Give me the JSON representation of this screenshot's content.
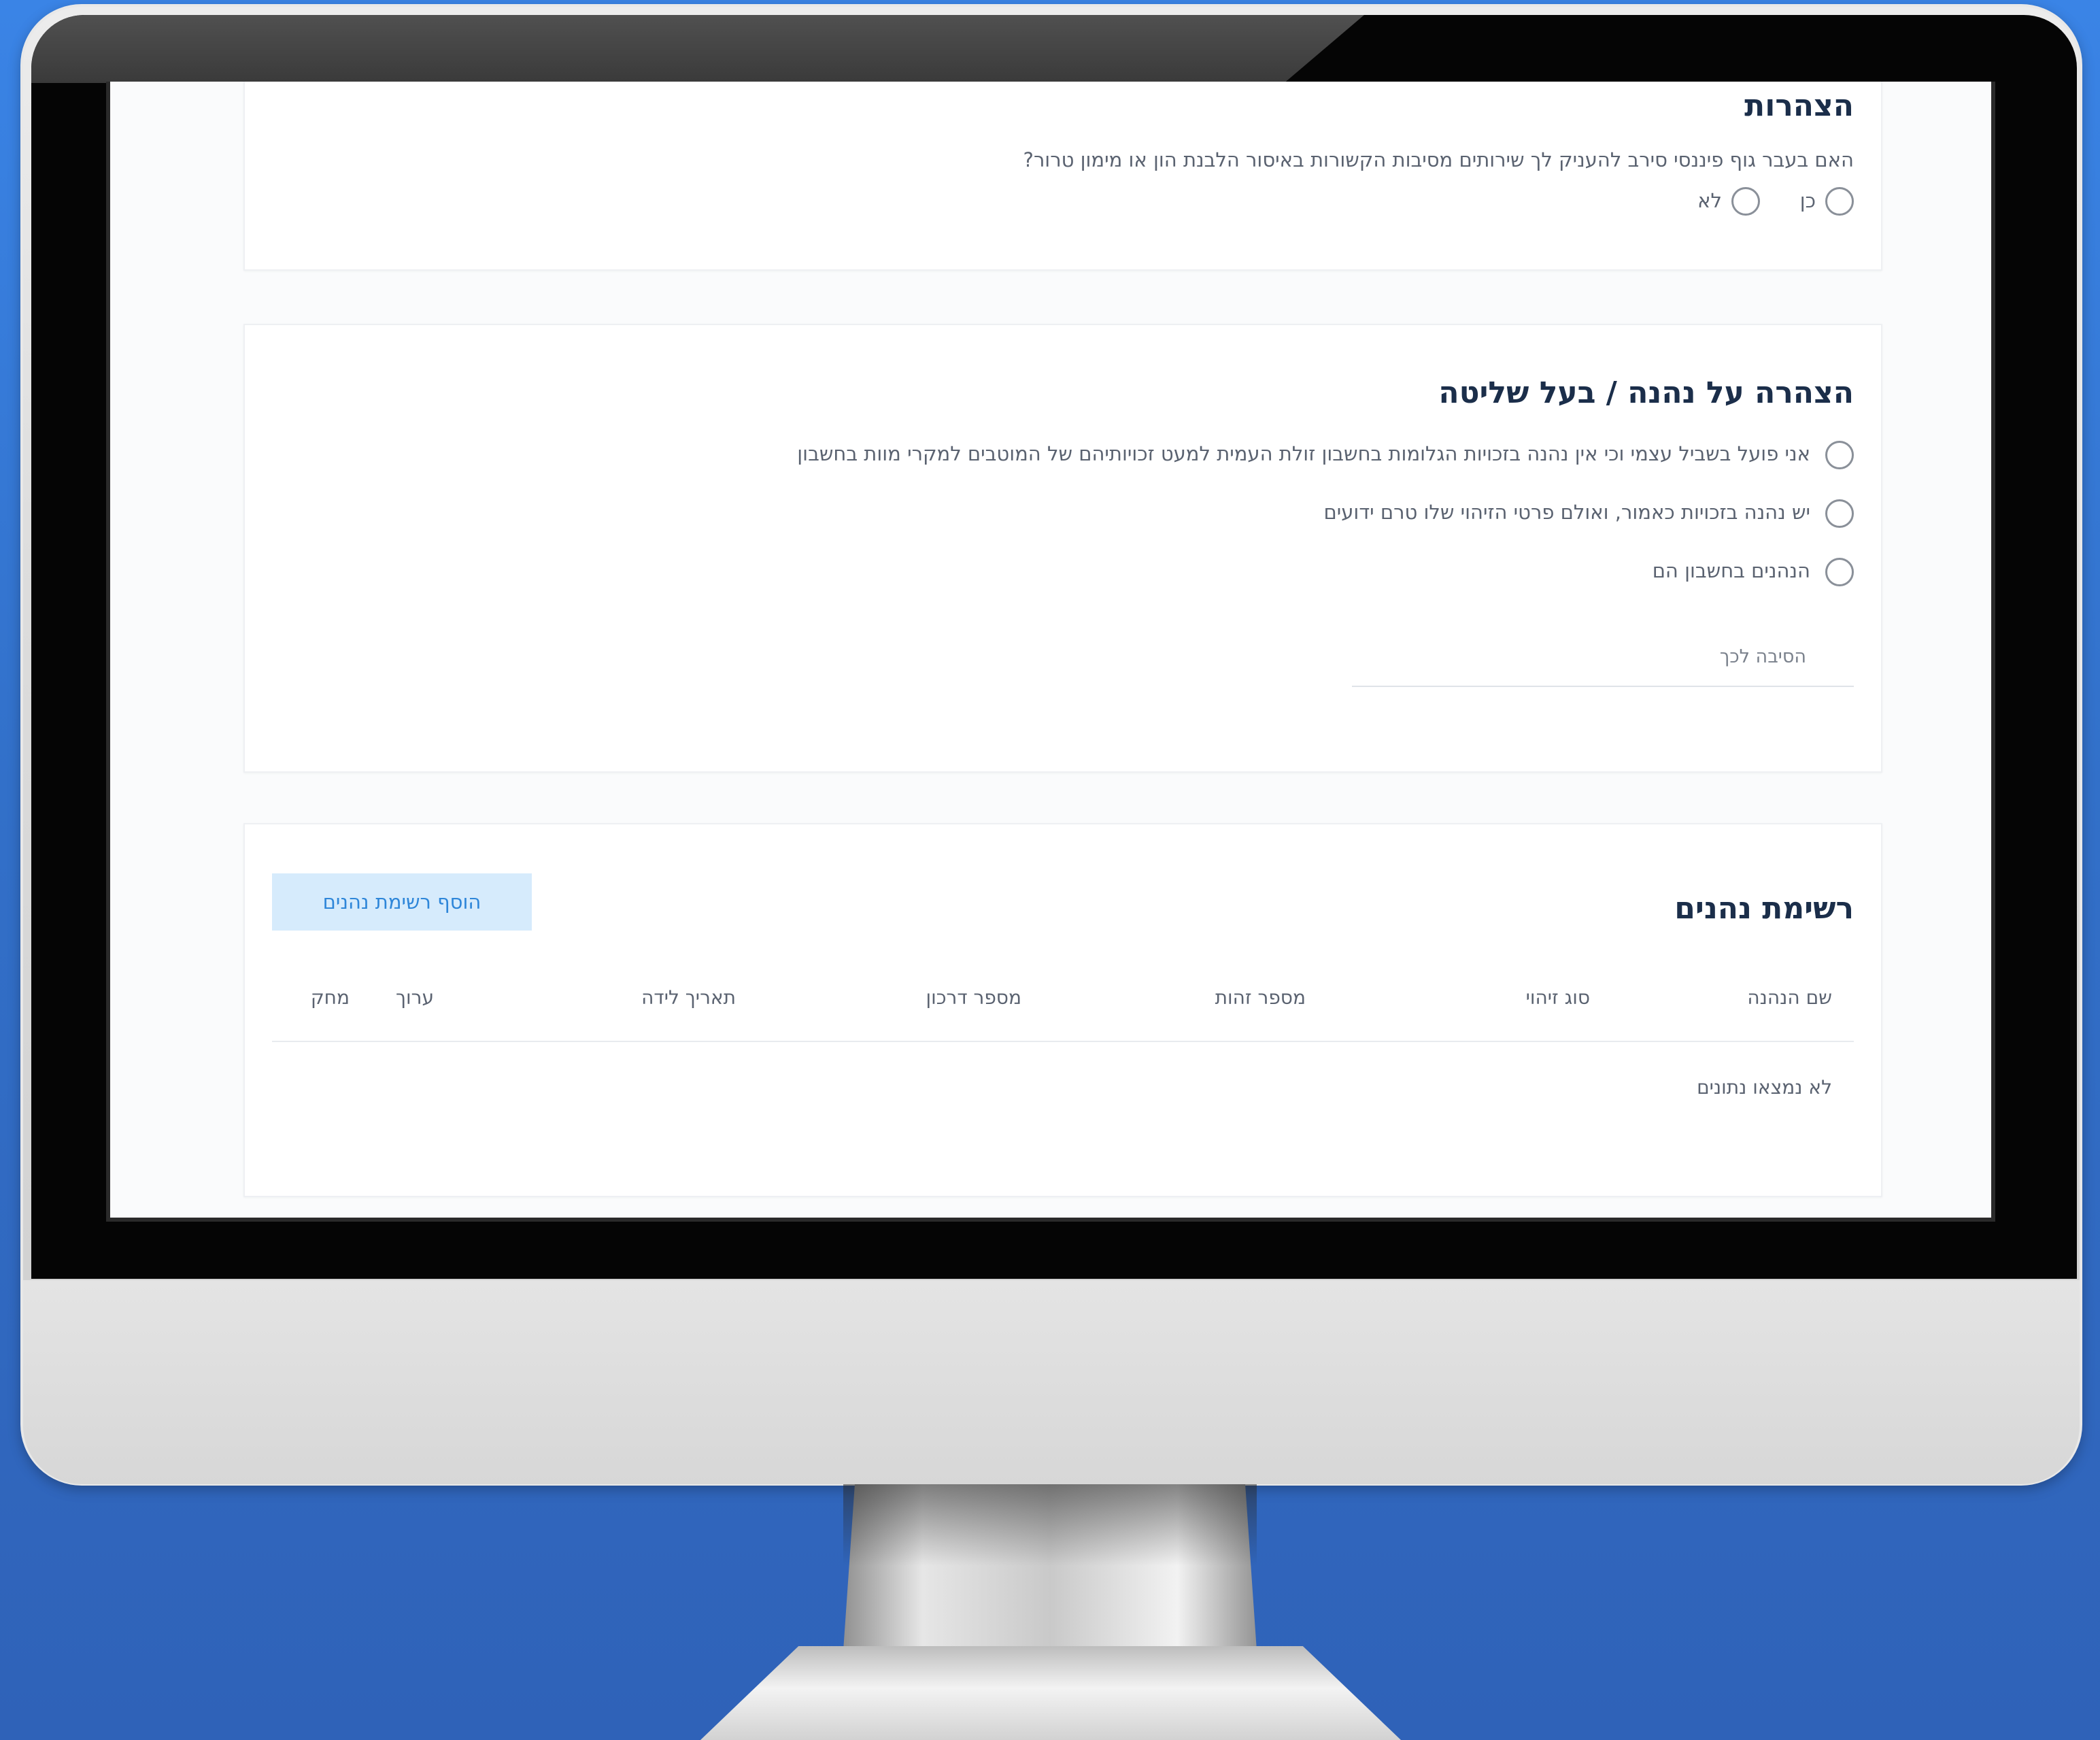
{
  "declarations": {
    "title": "הצהרות",
    "question": "האם בעבר גוף פיננסי סירב להעניק לך שירותים מסיבות הקשורות באיסור הלבנת הון או מימון טרור?",
    "options": [
      "כן",
      "לא"
    ]
  },
  "beneficiary_declaration": {
    "title": "הצהרה על נהנה / בעל שליטה",
    "options": [
      "אני פועל בשביל עצמי וכי אין נהנה בזכויות הגלומות בחשבון זולת העמית למעט זכויותיהם של המוטבים למקרי מוות בחשבון",
      "יש נהנה בזכויות כאמור, ואולם פרטי הזיהוי שלו טרם ידועים",
      "הנהנים בחשבון הם"
    ],
    "reason_label": "הסיבה לכך"
  },
  "beneficiaries_list": {
    "title": "רשימת נהנים",
    "add_button": "הוסף רשימת נהנים",
    "columns": [
      "שם הנהנה",
      "סוג זיהוי",
      "מספר זהות",
      "מספר דרכון",
      "תאריך לידה",
      "ערוך",
      "מחק"
    ],
    "empty_message": "לא נמצאו נתונים"
  }
}
